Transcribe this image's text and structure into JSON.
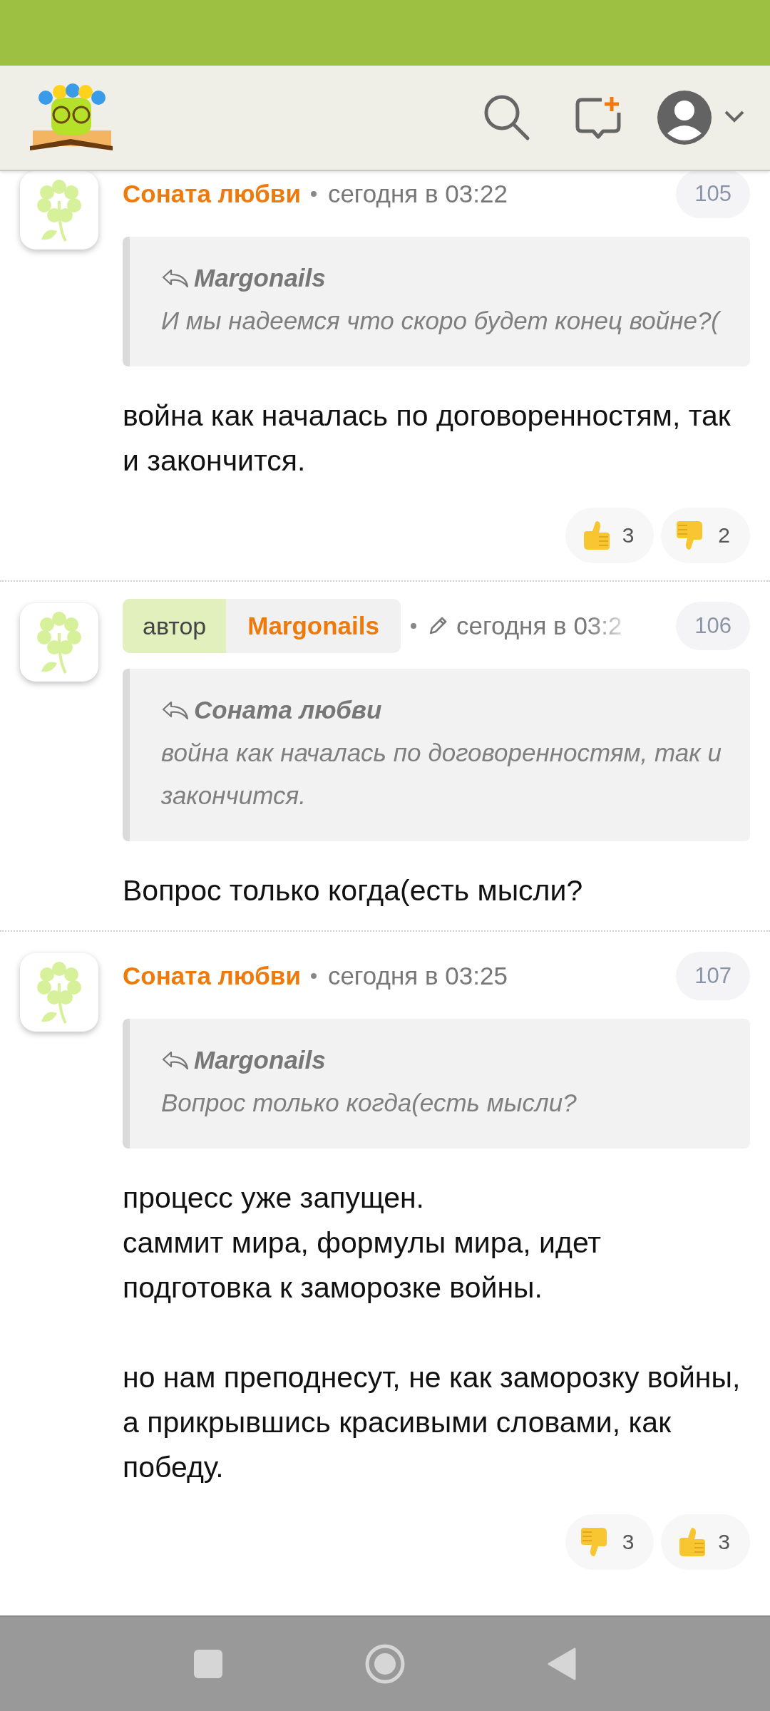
{
  "comments": [
    {
      "author": "Соната любви",
      "edited": false,
      "time": "сегодня в 03:22",
      "number": "105",
      "quote": {
        "author": "Margonails",
        "text": "И мы надеемся что скоро будет конец войне?("
      },
      "body": [
        "война как началась по договоренностям, так и закончится."
      ],
      "reactions": [
        {
          "kind": "like",
          "count": "3"
        },
        {
          "kind": "dislike",
          "count": "2"
        }
      ]
    },
    {
      "author": "Margonails",
      "badge": "автор",
      "edited": true,
      "time": "сегодня в 03:2",
      "number": "106",
      "quote": {
        "author": "Соната любви",
        "text": "война как началась по договоренностям, так и закончится."
      },
      "body": [
        "Вопрос только когда(есть мысли?"
      ]
    },
    {
      "author": "Соната любви",
      "edited": false,
      "time": "сегодня в 03:25",
      "number": "107",
      "quote": {
        "author": "Margonails",
        "text": "Вопрос только когда(есть мысли?"
      },
      "body": [
        "процесс уже запущен.\nсаммит мира, формулы мира, идет подготовка к заморозке войны.",
        "но нам преподнесут, не как заморозку войны, а прикрывшись красивыми словами, как победу."
      ],
      "reactions": [
        {
          "kind": "dislike",
          "count": "3"
        },
        {
          "kind": "like",
          "count": "3"
        }
      ]
    }
  ]
}
